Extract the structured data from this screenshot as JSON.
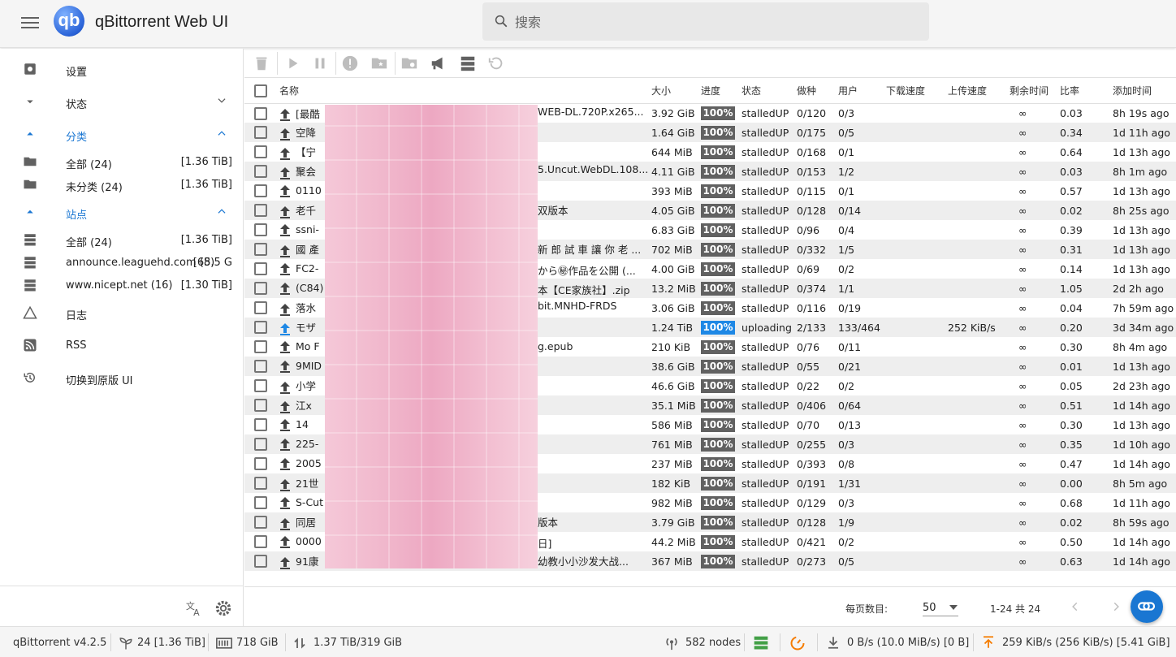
{
  "header": {
    "title": "qBittorrent Web UI",
    "logo_text": "qb",
    "search_placeholder": "搜索"
  },
  "sidebar": {
    "settings": "设置",
    "status": "状态",
    "categories": "分类",
    "cat_items": [
      {
        "label": "全部 (24)",
        "size": "[1.36 TiB]"
      },
      {
        "label": "未分类 (24)",
        "size": "[1.36 TiB]"
      }
    ],
    "sites": "站点",
    "site_items": [
      {
        "label": "全部 (24)",
        "size": "[1.36 TiB]"
      },
      {
        "label": "announce.leaguehd.com (8)",
        "size": "[65.5 G"
      },
      {
        "label": "www.nicept.net (16)",
        "size": "[1.30 TiB]"
      }
    ],
    "log": "日志",
    "rss": "RSS",
    "switch_ui": "切换到原版 UI"
  },
  "columns": [
    "名称",
    "大小",
    "进度",
    "状态",
    "做种",
    "用户",
    "下载速度",
    "上传速度",
    "剩余时间",
    "比率",
    "添加时间"
  ],
  "rows": [
    {
      "name": "[最酷",
      "tail": "WEB-DL.720P.x265...",
      "size": "3.92 GiB",
      "progress": "100%",
      "state": "stalledUP",
      "seeds": "0/120",
      "peers": "0/3",
      "dl": "",
      "ul": "",
      "eta": "∞",
      "ratio": "0.03",
      "added": "8h 19s ago"
    },
    {
      "name": "空降",
      "tail": "",
      "size": "1.64 GiB",
      "progress": "100%",
      "state": "stalledUP",
      "seeds": "0/175",
      "peers": "0/5",
      "dl": "",
      "ul": "",
      "eta": "∞",
      "ratio": "0.34",
      "added": "1d 11h ago"
    },
    {
      "name": "【宁",
      "tail": "",
      "size": "644 MiB",
      "progress": "100%",
      "state": "stalledUP",
      "seeds": "0/168",
      "peers": "0/1",
      "dl": "",
      "ul": "",
      "eta": "∞",
      "ratio": "0.64",
      "added": "1d 13h ago"
    },
    {
      "name": "聚会",
      "tail": "5.Uncut.WebDL.108...",
      "size": "4.11 GiB",
      "progress": "100%",
      "state": "stalledUP",
      "seeds": "0/153",
      "peers": "1/2",
      "dl": "",
      "ul": "",
      "eta": "∞",
      "ratio": "0.03",
      "added": "8h 1m ago"
    },
    {
      "name": "0110",
      "tail": "",
      "size": "393 MiB",
      "progress": "100%",
      "state": "stalledUP",
      "seeds": "0/115",
      "peers": "0/1",
      "dl": "",
      "ul": "",
      "eta": "∞",
      "ratio": "0.57",
      "added": "1d 13h ago"
    },
    {
      "name": "老千",
      "tail": "双版本",
      "size": "4.05 GiB",
      "progress": "100%",
      "state": "stalledUP",
      "seeds": "0/128",
      "peers": "0/14",
      "dl": "",
      "ul": "",
      "eta": "∞",
      "ratio": "0.02",
      "added": "8h 25s ago"
    },
    {
      "name": "ssni-",
      "tail": "",
      "size": "6.83 GiB",
      "progress": "100%",
      "state": "stalledUP",
      "seeds": "0/96",
      "peers": "0/4",
      "dl": "",
      "ul": "",
      "eta": "∞",
      "ratio": "0.39",
      "added": "1d 13h ago"
    },
    {
      "name": "國 產",
      "tail": "新 郎 試 車 讓 你 老 ...",
      "size": "702 MiB",
      "progress": "100%",
      "state": "stalledUP",
      "seeds": "0/332",
      "peers": "1/5",
      "dl": "",
      "ul": "",
      "eta": "∞",
      "ratio": "0.31",
      "added": "1d 13h ago"
    },
    {
      "name": "FC2-",
      "tail": "から㊙作品を公開 (...",
      "size": "4.00 GiB",
      "progress": "100%",
      "state": "stalledUP",
      "seeds": "0/69",
      "peers": "0/2",
      "dl": "",
      "ul": "",
      "eta": "∞",
      "ratio": "0.14",
      "added": "1d 13h ago"
    },
    {
      "name": "(C84)",
      "tail": "本【CE家族社】.zip",
      "size": "13.2 MiB",
      "progress": "100%",
      "state": "stalledUP",
      "seeds": "0/374",
      "peers": "1/1",
      "dl": "",
      "ul": "",
      "eta": "∞",
      "ratio": "1.05",
      "added": "2d 2h ago"
    },
    {
      "name": "落水",
      "tail": "bit.MNHD-FRDS",
      "size": "3.06 GiB",
      "progress": "100%",
      "state": "stalledUP",
      "seeds": "0/116",
      "peers": "0/19",
      "dl": "",
      "ul": "",
      "eta": "∞",
      "ratio": "0.04",
      "added": "7h 59m ago"
    },
    {
      "name": "モザ",
      "tail": "",
      "size": "1.24 TiB",
      "progress": "100%",
      "state": "uploading",
      "seeds": "2/133",
      "peers": "133/464",
      "dl": "",
      "ul": "252 KiB/s",
      "eta": "∞",
      "ratio": "0.20",
      "added": "3d 34m ago",
      "active": true
    },
    {
      "name": "Mo F",
      "tail": "g.epub",
      "size": "210 KiB",
      "progress": "100%",
      "state": "stalledUP",
      "seeds": "0/76",
      "peers": "0/11",
      "dl": "",
      "ul": "",
      "eta": "∞",
      "ratio": "0.30",
      "added": "8h 4m ago"
    },
    {
      "name": "9MID",
      "tail": "",
      "size": "38.6 GiB",
      "progress": "100%",
      "state": "stalledUP",
      "seeds": "0/55",
      "peers": "0/21",
      "dl": "",
      "ul": "",
      "eta": "∞",
      "ratio": "0.01",
      "added": "1d 13h ago"
    },
    {
      "name": "小学",
      "tail": "",
      "size": "46.6 GiB",
      "progress": "100%",
      "state": "stalledUP",
      "seeds": "0/22",
      "peers": "0/2",
      "dl": "",
      "ul": "",
      "eta": "∞",
      "ratio": "0.05",
      "added": "2d 23h ago"
    },
    {
      "name": "江x",
      "tail": "",
      "size": "35.1 MiB",
      "progress": "100%",
      "state": "stalledUP",
      "seeds": "0/406",
      "peers": "0/64",
      "dl": "",
      "ul": "",
      "eta": "∞",
      "ratio": "0.51",
      "added": "1d 14h ago"
    },
    {
      "name": "14",
      "tail": "",
      "size": "586 MiB",
      "progress": "100%",
      "state": "stalledUP",
      "seeds": "0/70",
      "peers": "0/13",
      "dl": "",
      "ul": "",
      "eta": "∞",
      "ratio": "0.30",
      "added": "1d 13h ago"
    },
    {
      "name": "225-",
      "tail": "",
      "size": "761 MiB",
      "progress": "100%",
      "state": "stalledUP",
      "seeds": "0/255",
      "peers": "0/3",
      "dl": "",
      "ul": "",
      "eta": "∞",
      "ratio": "0.35",
      "added": "1d 10h ago"
    },
    {
      "name": "2005",
      "tail": "",
      "size": "237 MiB",
      "progress": "100%",
      "state": "stalledUP",
      "seeds": "0/393",
      "peers": "0/8",
      "dl": "",
      "ul": "",
      "eta": "∞",
      "ratio": "0.47",
      "added": "1d 14h ago"
    },
    {
      "name": "21世",
      "tail": "",
      "size": "182 KiB",
      "progress": "100%",
      "state": "stalledUP",
      "seeds": "0/191",
      "peers": "1/31",
      "dl": "",
      "ul": "",
      "eta": "∞",
      "ratio": "0.00",
      "added": "8h 5m ago"
    },
    {
      "name": "S-Cut",
      "tail": "",
      "size": "982 MiB",
      "progress": "100%",
      "state": "stalledUP",
      "seeds": "0/129",
      "peers": "0/3",
      "dl": "",
      "ul": "",
      "eta": "∞",
      "ratio": "0.68",
      "added": "1d 11h ago"
    },
    {
      "name": "同居",
      "tail": "版本",
      "size": "3.79 GiB",
      "progress": "100%",
      "state": "stalledUP",
      "seeds": "0/128",
      "peers": "1/9",
      "dl": "",
      "ul": "",
      "eta": "∞",
      "ratio": "0.02",
      "added": "8h 59s ago"
    },
    {
      "name": "0000",
      "tail": "日]",
      "size": "44.2 MiB",
      "progress": "100%",
      "state": "stalledUP",
      "seeds": "0/421",
      "peers": "0/2",
      "dl": "",
      "ul": "",
      "eta": "∞",
      "ratio": "0.50",
      "added": "1d 14h ago"
    },
    {
      "name": "91康",
      "tail": "幼教小小沙发大战...",
      "size": "367 MiB",
      "progress": "100%",
      "state": "stalledUP",
      "seeds": "0/273",
      "peers": "0/5",
      "dl": "",
      "ul": "",
      "eta": "∞",
      "ratio": "0.63",
      "added": "1d 14h ago"
    }
  ],
  "pager": {
    "per_page_label": "每页数目:",
    "per_page": "50",
    "range": "1-24 共 24"
  },
  "status": {
    "version": "qBittorrent v4.2.5",
    "torrents": "24 [1.36 TiB]",
    "free_space": "718 GiB",
    "alltime": "1.37 TiB/319 GiB",
    "dht": "582 nodes",
    "download": "0 B/s (10.0 MiB/s) [0 B]",
    "upload": "259 KiB/s (256 KiB/s) [5.41 GiB]"
  },
  "colors": {
    "accent": "#1976d2",
    "progress": "#616161",
    "upload_icon": "#f57c00",
    "connection": "#43a047"
  }
}
